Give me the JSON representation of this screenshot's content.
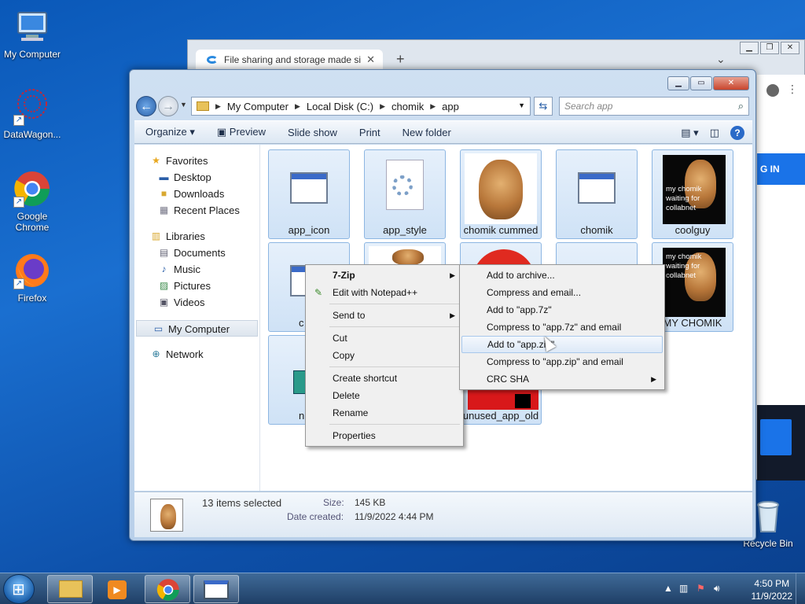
{
  "desktop": {
    "icons": [
      {
        "label": "My Computer"
      },
      {
        "label": "DataWagon..."
      },
      {
        "label": "Google Chrome"
      },
      {
        "label": "Firefox"
      },
      {
        "label": "Recycle Bin"
      }
    ]
  },
  "browser": {
    "tab_title": "File sharing and storage made si",
    "new_tab": "+",
    "login_label": "G IN"
  },
  "explorer": {
    "address": [
      "My Computer",
      "Local Disk (C:)",
      "chomik",
      "app"
    ],
    "search_placeholder": "Search app",
    "toolbar": {
      "organize": "Organize ▾",
      "preview": "Preview",
      "slideshow": "Slide show",
      "print": "Print",
      "new_folder": "New folder"
    },
    "nav": {
      "favorites": "Favorites",
      "desktop": "Desktop",
      "downloads": "Downloads",
      "recent": "Recent Places",
      "libraries": "Libraries",
      "documents": "Documents",
      "music": "Music",
      "pictures": "Pictures",
      "videos": "Videos",
      "my_computer": "My Computer",
      "network": "Network"
    },
    "files": [
      {
        "label": "app_icon"
      },
      {
        "label": "app_style"
      },
      {
        "label": "chomik cummed"
      },
      {
        "label": "chomik"
      },
      {
        "label": "coolguy",
        "caption": "my chomik waiting for collabnet"
      },
      {
        "label": "MY CHOMIK",
        "caption": "my chomik waiting for collabnet"
      },
      {
        "label": "unused_app_old"
      },
      {
        "label": "c"
      },
      {
        "label": "n"
      }
    ],
    "details": {
      "selected": "13 items selected",
      "size_label": "Size:",
      "size_value": "145 KB",
      "date_label": "Date created:",
      "date_value": "11/9/2022 4:44 PM"
    }
  },
  "context_menu": {
    "items": [
      "7-Zip",
      "Edit with Notepad++",
      "Send to",
      "Cut",
      "Copy",
      "Create shortcut",
      "Delete",
      "Rename",
      "Properties"
    ]
  },
  "submenu": {
    "items": [
      "Add to archive...",
      "Compress and email...",
      "Add to \"app.7z\"",
      "Compress to \"app.7z\" and email",
      "Add to \"app.zip\"",
      "Compress to \"app.zip\" and email",
      "CRC SHA"
    ]
  },
  "taskbar": {
    "time": "4:50 PM",
    "date": "11/9/2022"
  }
}
